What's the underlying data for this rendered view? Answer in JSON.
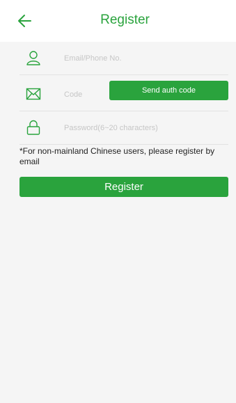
{
  "header": {
    "back_icon": "back-arrow-icon",
    "title": "Register"
  },
  "form": {
    "account": {
      "icon": "user-icon",
      "placeholder": "Email/Phone No.",
      "value": ""
    },
    "code": {
      "icon": "mail-icon",
      "placeholder": "Code",
      "value": "",
      "send_button_label": "Send auth code"
    },
    "password": {
      "icon": "lock-icon",
      "placeholder": "Password(6~20 characters)",
      "value": ""
    },
    "note": "*For non-mainland Chinese users, please register by email",
    "register_button_label": "Register"
  },
  "colors": {
    "accent": "#2aa33d",
    "background": "#f5f5f5",
    "header_background": "#ffffff"
  }
}
